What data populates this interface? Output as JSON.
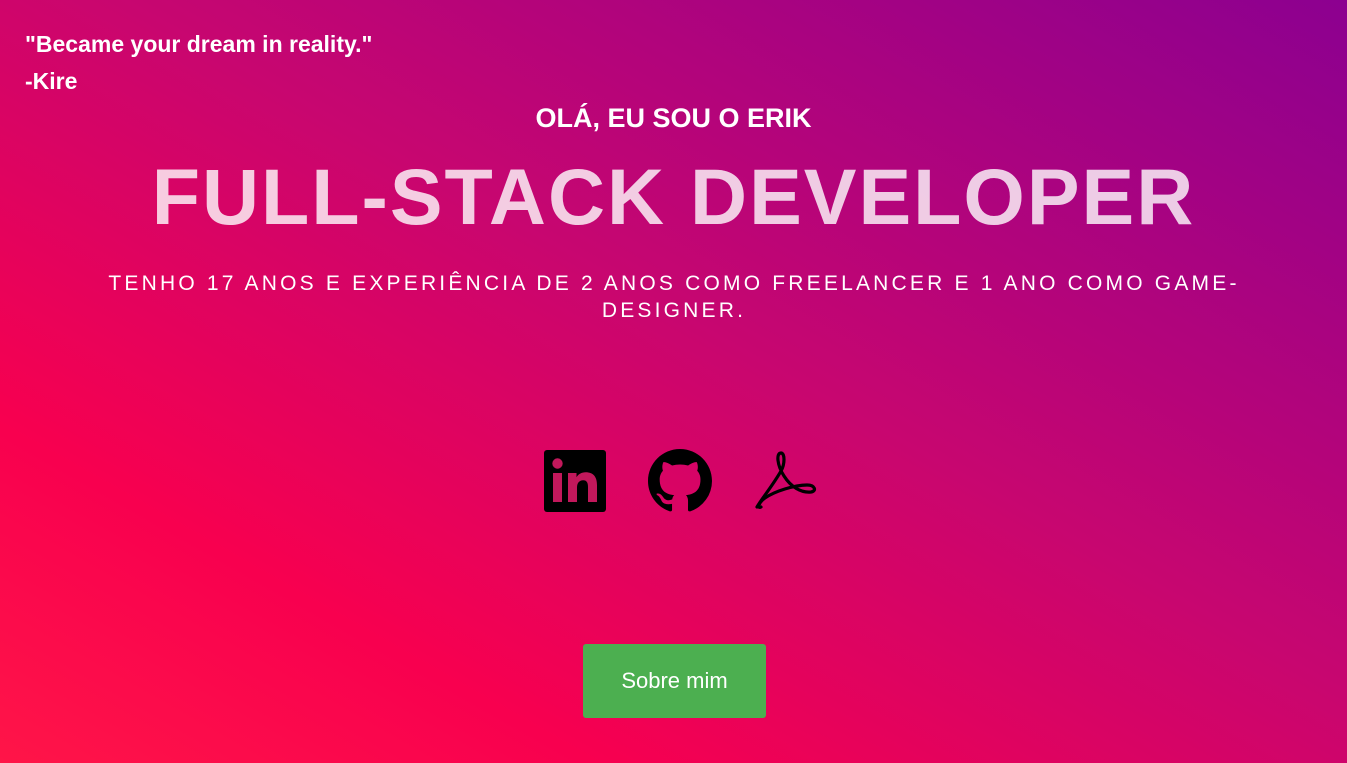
{
  "header": {
    "quote": "\"Became your dream in reality.\"",
    "author": "-Kire"
  },
  "hero": {
    "greeting": "OLÁ, EU SOU O ERIK",
    "role": "FULL-STACK DEVELOPER",
    "bio": "TENHO 17 ANOS E EXPERIÊNCIA DE 2 ANOS COMO FREELANCER E 1 ANO COMO GAME-DESIGNER."
  },
  "socials": [
    {
      "icon": "linkedin-icon"
    },
    {
      "icon": "github-icon"
    },
    {
      "icon": "adobe-acrobat-pdf-icon"
    }
  ],
  "about_button": {
    "label": "Sobre mim",
    "color": "#4caf50"
  },
  "colors": {
    "gradient_start": "#ff1548",
    "gradient_mid": "#f8004f",
    "gradient_end": "#8c0090",
    "text": "#ffffff"
  }
}
